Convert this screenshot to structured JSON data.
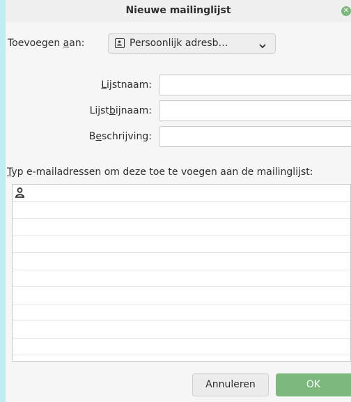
{
  "dialog": {
    "title": "Nieuwe mailinglijst",
    "close_icon": "close-icon",
    "close_glyph": "✕"
  },
  "add_to": {
    "label_pre": "Toevoegen ",
    "label_accel": "a",
    "label_post": "an:",
    "addressbook_value": "Persoonlijk adresb…",
    "addressbook_icon": "address-book-icon",
    "chevron_icon": "chevron-down-icon"
  },
  "fields": {
    "list_name": {
      "accel": "L",
      "rest": "ijstnaam:",
      "value": ""
    },
    "list_nickname": {
      "pre": "Lijst",
      "accel": "b",
      "rest": "ijnaam:",
      "value": ""
    },
    "description": {
      "pre": "B",
      "accel": "e",
      "rest": "schrijving:",
      "value": ""
    }
  },
  "members": {
    "label_accel": "T",
    "label_rest": "yp e-mailadressen om deze toe te voegen aan de mailinglijst:",
    "entry_icon": "person-icon",
    "rows": [
      "",
      "",
      "",
      "",
      "",
      "",
      "",
      "",
      "",
      ""
    ]
  },
  "buttons": {
    "cancel": "Annuleren",
    "ok": "OK"
  },
  "colors": {
    "accent": "#7cb87c",
    "background": "#bfeff3"
  }
}
